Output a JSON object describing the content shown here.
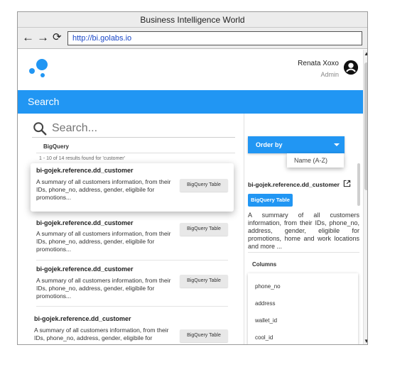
{
  "browser": {
    "title": "Business Intelligence World",
    "url": "http://bi.golabs.io",
    "back_icon": "←",
    "forward_icon": "→",
    "reload_icon": "⟳"
  },
  "header": {
    "user_name": "Renata Xoxo",
    "user_role": "Admin"
  },
  "search_bar": {
    "title": "Search"
  },
  "search": {
    "placeholder": "Search...",
    "source": "BigQuery",
    "results_count": "1 - 10 of 14 results found for 'customer'"
  },
  "results": [
    {
      "title": "bi-gojek.reference.dd_customer",
      "description": "A summary of all customers information, from their IDs, phone_no, address, gender, eligibile for promotions...",
      "tag": "BigQuery Table"
    },
    {
      "title": "bi-gojek.reference.dd_customer",
      "description": "A summary of all customers information, from their IDs, phone_no, address, gender, eligibile for promotions...",
      "tag": "BigQuery Table"
    },
    {
      "title": "bi-gojek.reference.dd_customer",
      "description": "A summary of all customers information, from their IDs, phone_no, address, gender, eligibile for promotions...",
      "tag": "BigQuery Table"
    },
    {
      "title": "bi-gojek.reference.dd_customer",
      "description": "A summary of all customers information, from their IDs, phone_no, address, gender, eligibile for",
      "tag": "BigQuery Table"
    }
  ],
  "order_by": {
    "label": "Order by",
    "options": [
      "Name (A-Z)"
    ]
  },
  "detail": {
    "title": "bi-gojek.reference.dd_customer",
    "tag": "BigQuery Table",
    "description": "A summary of all customers information, from their IDs, phone_no, address, gender, eligibile for promotions, home and work locations and more ...",
    "columns_label": "Columns",
    "columns": [
      "phone_no",
      "address",
      "wallet_id",
      "cool_id"
    ]
  },
  "colors": {
    "accent": "#2196f3",
    "url_text": "#1a47c8"
  },
  "icons": {
    "back": "arrow-left-icon",
    "forward": "arrow-right-icon",
    "reload": "reload-icon",
    "user": "account-circle-icon",
    "search": "search-icon",
    "open": "open-external-icon",
    "dropdown": "caret-down-icon"
  }
}
